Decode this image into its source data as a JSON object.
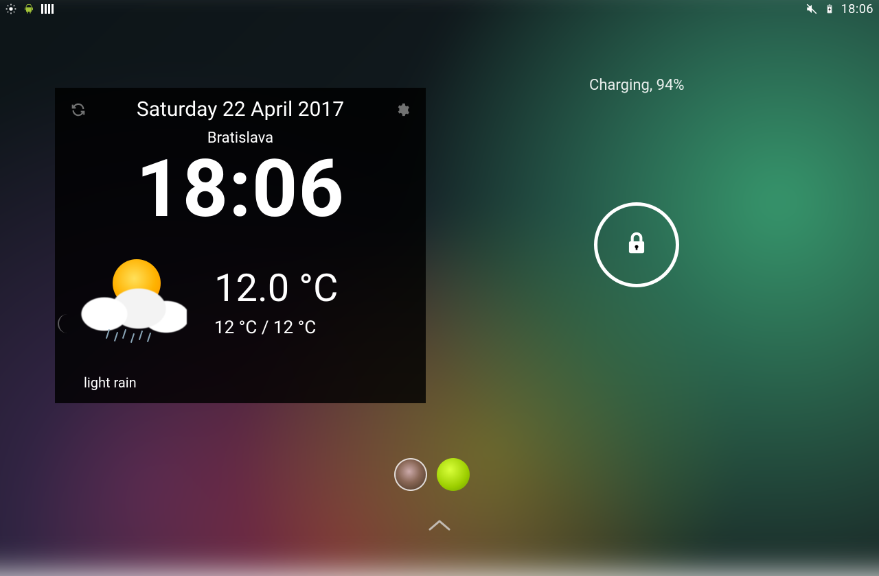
{
  "statusbar": {
    "left_icons": [
      "brightness-icon",
      "android-icon",
      "barcode-icon"
    ],
    "right_icons": [
      "mute-icon",
      "battery-charging-icon"
    ],
    "clock": "18:06"
  },
  "widget": {
    "date": "Saturday 22 April 2017",
    "location": "Bratislava",
    "clock": "18:06",
    "temperature": "12.0 °C",
    "temp_range": "12 °C / 12 °C",
    "condition": "light rain"
  },
  "lock": {
    "charging_text": "Charging, 94%"
  }
}
